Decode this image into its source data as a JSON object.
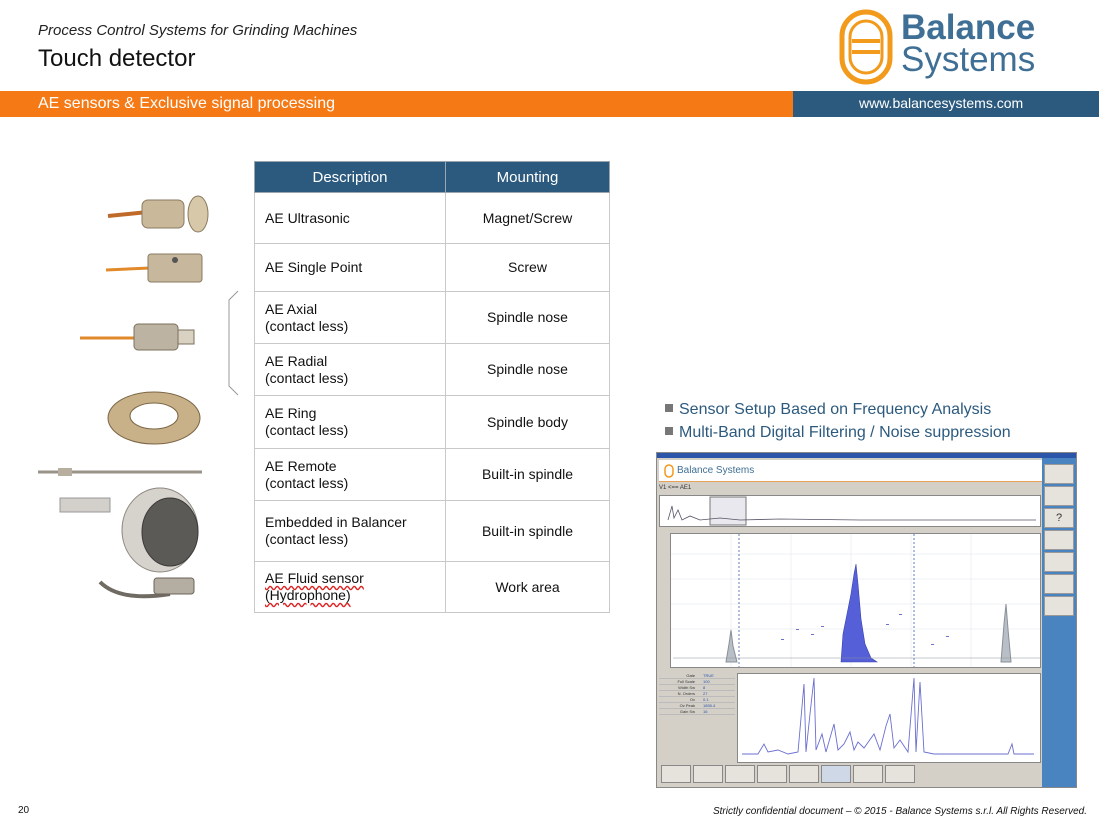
{
  "header": {
    "subtitle": "Process Control Systems for Grinding Machines",
    "title": "Touch detector",
    "logo_line1": "Balance",
    "logo_line2": "Systems",
    "band_left": "AE sensors & Exclusive signal processing",
    "band_right": "www.balancesystems.com"
  },
  "colors": {
    "orange": "#f57a16",
    "blue": "#2c5a7e",
    "logo_orange": "#f29a1b"
  },
  "table": {
    "headers": [
      "Description",
      "Mounting"
    ],
    "rows": [
      {
        "desc1": "AE Ultrasonic",
        "desc2": "",
        "mount": "Magnet/Screw"
      },
      {
        "desc1": "AE Single Point",
        "desc2": "",
        "mount": "Screw"
      },
      {
        "desc1": "AE Axial",
        "desc2": "(contact less)",
        "mount": "Spindle nose"
      },
      {
        "desc1": "AE Radial",
        "desc2": "(contact less)",
        "mount": "Spindle nose"
      },
      {
        "desc1": "AE Ring",
        "desc2": "(contact less)",
        "mount": "Spindle body"
      },
      {
        "desc1": "AE Remote",
        "desc2": "(contact less)",
        "mount": "Built-in spindle"
      },
      {
        "desc1": "Embedded in Balancer",
        "desc2": "(contact less)",
        "mount": "Built-in spindle"
      },
      {
        "desc1": "AE Fluid sensor",
        "desc2": "(Hydrophone)",
        "mount": "Work area"
      }
    ]
  },
  "bullets": [
    "Sensor Setup Based on Frequency Analysis",
    "Multi-Band Digital Filtering / Noise suppression"
  ],
  "software": {
    "app_title": "Balance Systems",
    "breadcrumb": "V1 <== AE1",
    "side_q": "?",
    "params": [
      {
        "k": "Gate",
        "v": "TRUE"
      },
      {
        "k": "Full Scale",
        "v": "100"
      },
      {
        "k": "Width Sw",
        "v": "8"
      },
      {
        "k": "N. Orders",
        "v": "27"
      },
      {
        "k": "Ov",
        "v": "0.1"
      },
      {
        "k": "Ov Peak",
        "v": "1855.4"
      },
      {
        "k": "Gain Sw",
        "v": "16"
      }
    ]
  },
  "footer": {
    "page": "20",
    "text": "Strictly confidential document – © 2015 - Balance Systems s.r.l. All Rights Reserved."
  }
}
